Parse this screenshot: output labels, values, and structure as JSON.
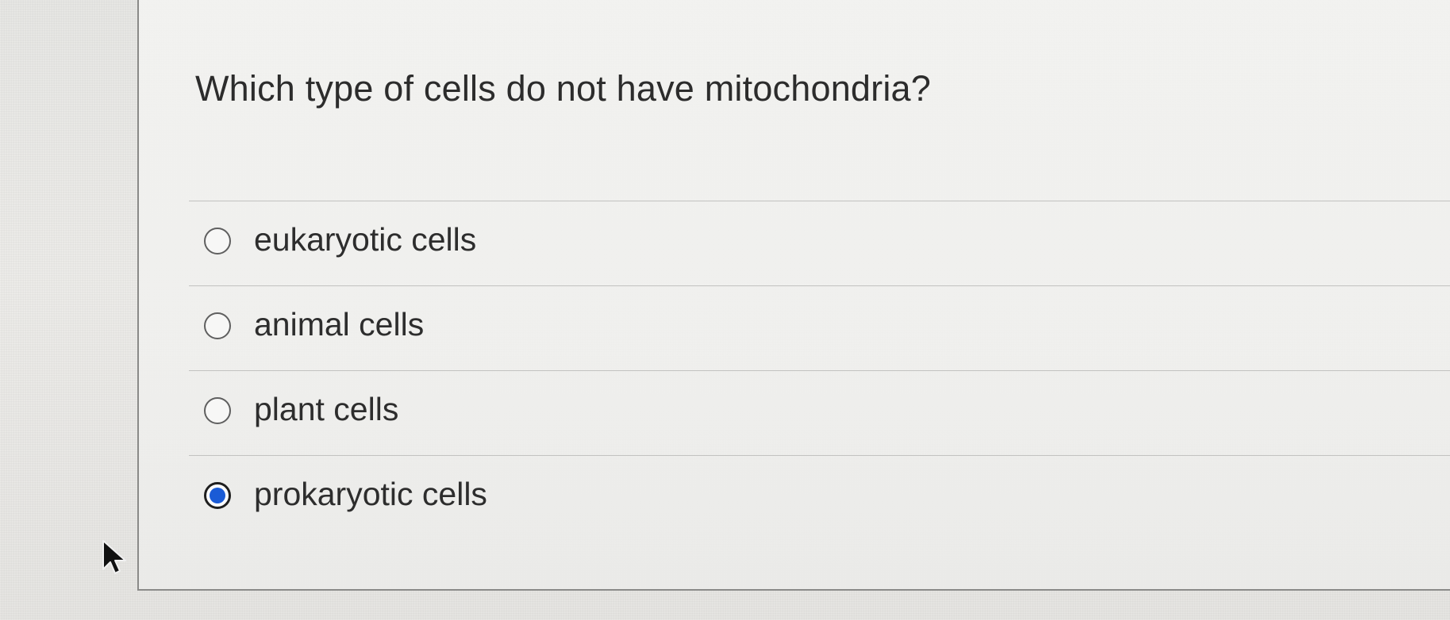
{
  "question": {
    "text": "Which type of cells do not have mitochondria?"
  },
  "options": [
    {
      "label": "eukaryotic cells",
      "selected": false
    },
    {
      "label": "animal cells",
      "selected": false
    },
    {
      "label": "plant cells",
      "selected": false
    },
    {
      "label": "prokaryotic cells",
      "selected": true
    }
  ],
  "colors": {
    "selected_radio": "#1a5bd6",
    "text": "#2d2d2d",
    "divider": "#c2c2c0"
  },
  "icons": {
    "cursor": "mouse-pointer-icon",
    "radio": "radio-button-icon"
  }
}
